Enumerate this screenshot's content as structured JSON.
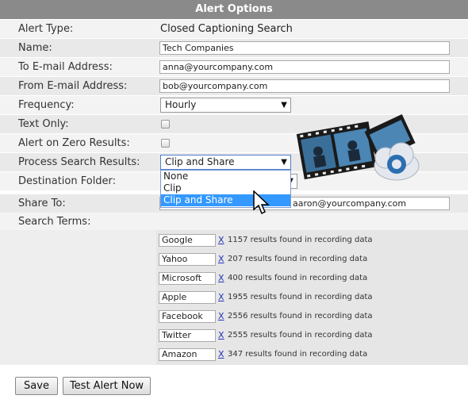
{
  "header": {
    "title": "Alert Options"
  },
  "fields": {
    "alert_type": {
      "label": "Alert Type:",
      "value": "Closed Captioning Search"
    },
    "name": {
      "label": "Name:",
      "value": "Tech Companies"
    },
    "to_email": {
      "label": "To E-mail Address:",
      "value": "anna@yourcompany.com"
    },
    "from_email": {
      "label": "From E-mail Address:",
      "value": "bob@yourcompany.com"
    },
    "frequency": {
      "label": "Frequency:",
      "value": "Hourly"
    },
    "text_only": {
      "label": "Text Only:",
      "checked": false
    },
    "alert_zero": {
      "label": "Alert on Zero Results:",
      "checked": false
    },
    "process": {
      "label": "Process Search Results:",
      "value": "Clip and Share",
      "options": [
        "None",
        "Clip",
        "Clip and Share"
      ]
    },
    "destination": {
      "label": "Destination Folder:"
    },
    "share_to": {
      "label": "Share To:",
      "value": "aaron@yourcompany.com"
    },
    "search_terms": {
      "label": "Search Terms:"
    }
  },
  "terms": [
    {
      "term": "Google",
      "remove": "X",
      "result": "1157 results found in recording data"
    },
    {
      "term": "Yahoo",
      "remove": "X",
      "result": "207 results found in recording data"
    },
    {
      "term": "Microsoft",
      "remove": "X",
      "result": "400 results found in recording data"
    },
    {
      "term": "Apple",
      "remove": "X",
      "result": "1955 results found in recording data"
    },
    {
      "term": "Facebook",
      "remove": "X",
      "result": "2556 results found in recording data"
    },
    {
      "term": "Twitter",
      "remove": "X",
      "result": "2555 results found in recording data"
    },
    {
      "term": "Amazon",
      "remove": "X",
      "result": "347 results found in recording data"
    }
  ],
  "buttons": {
    "save": "Save",
    "test": "Test Alert Now"
  },
  "colors": {
    "header_bg": "#8a8a8a",
    "selected_option": "#3399ff",
    "link": "#2233bb"
  }
}
